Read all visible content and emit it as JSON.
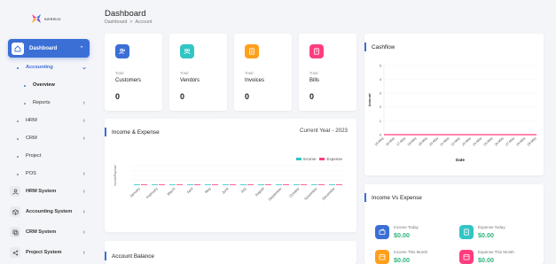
{
  "brand": {
    "wordmark": "SERRIO"
  },
  "sidebar": {
    "dashboard": "Dashboard",
    "accounting": "Accounting",
    "overview": "Overview",
    "reports": "Reports",
    "hrm": "HRM",
    "crm": "CRM",
    "project": "Project",
    "pos": "POS",
    "systems": [
      {
        "label": "HRM System",
        "icon": "user-icon"
      },
      {
        "label": "Accounting System",
        "icon": "box-icon"
      },
      {
        "label": "CRM System",
        "icon": "layers-icon"
      },
      {
        "label": "Project System",
        "icon": "share-icon"
      }
    ]
  },
  "header": {
    "title": "Dashboard",
    "crumb_home": "Dashboard",
    "crumb_sep": ">",
    "crumb_current": "Account"
  },
  "stats": [
    {
      "small": "Total",
      "name": "Customers",
      "value": "0",
      "color": "#3b6fd6",
      "icon": "users-icon"
    },
    {
      "small": "Total",
      "name": "Vendors",
      "value": "0",
      "color": "#32c5c5",
      "icon": "vendor-icon"
    },
    {
      "small": "Total",
      "name": "Invoices",
      "value": "0",
      "color": "#ff9f1c",
      "icon": "invoice-icon"
    },
    {
      "small": "Total",
      "name": "Bills",
      "value": "0",
      "color": "#ff3d7f",
      "icon": "bill-icon"
    }
  ],
  "income_expense": {
    "title": "Income & Expense",
    "period": "Current Year - 2023",
    "legend_income": "Income",
    "legend_expense": "Expense",
    "color_income": "#32c5c5",
    "color_expense": "#ff3d7f",
    "yaxis_label": "Income/Expense"
  },
  "cashflow": {
    "title": "Cashflow",
    "ylabel": "Amount",
    "xlabel": "Date",
    "yticks": [
      "5",
      "4",
      "3",
      "2",
      "1",
      "0"
    ],
    "color": "#ff3d7f"
  },
  "income_vs_expense": {
    "title": "Income Vs Expense",
    "items": [
      {
        "label": "Income Today",
        "value": "$0.00",
        "color": "#3b6fd6"
      },
      {
        "label": "Expense Today",
        "value": "$0.00",
        "color": "#32c5c5"
      },
      {
        "label": "Income This Month",
        "value": "$0.00",
        "color": "#ff9f1c"
      },
      {
        "label": "Expense This Month",
        "value": "$0.00",
        "color": "#ff3d7f"
      }
    ]
  },
  "account_balance": {
    "title": "Account Balance"
  },
  "chart_data": [
    {
      "type": "bar",
      "title": "Income & Expense",
      "ylabel": "Income/Expense",
      "categories": [
        "January",
        "February",
        "March",
        "April",
        "May",
        "June",
        "July",
        "August",
        "September",
        "October",
        "November",
        "December"
      ],
      "series": [
        {
          "name": "Income",
          "values": [
            0,
            0,
            0,
            0,
            0,
            0,
            0,
            0,
            0,
            0,
            0,
            0
          ]
        },
        {
          "name": "Expense",
          "values": [
            0,
            0,
            0,
            0,
            0,
            0,
            0,
            0,
            0,
            0,
            0,
            0
          ]
        }
      ],
      "legend": "top-right"
    },
    {
      "type": "line",
      "title": "Cashflow",
      "xlabel": "Date",
      "ylabel": "Amount",
      "x": [
        "15-May",
        "16-May",
        "17-May",
        "18-May",
        "19-May",
        "20-May",
        "21-May",
        "22-May",
        "23-May",
        "24-May",
        "25-May",
        "26-May",
        "27-May",
        "28-May",
        "29-May"
      ],
      "series": [
        {
          "values": [
            0,
            0,
            0,
            0,
            0,
            0,
            0,
            0,
            0,
            0,
            0,
            0,
            0,
            0,
            0
          ]
        }
      ],
      "ylim": [
        0,
        5
      ]
    }
  ]
}
